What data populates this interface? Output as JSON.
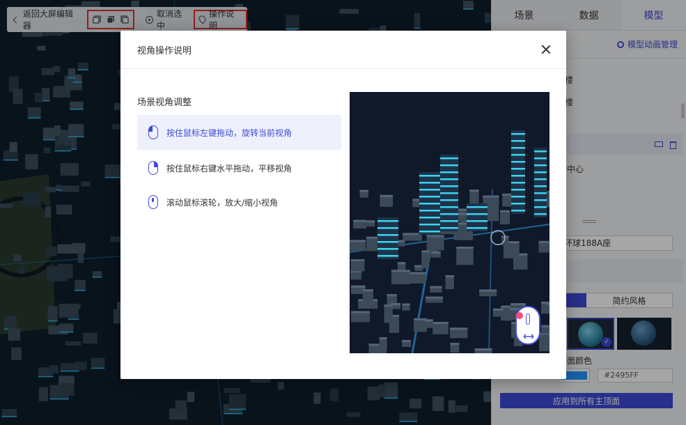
{
  "toolbar": {
    "back_label": "返回大屏编辑器",
    "deselect_label": "取消选中",
    "help_label": "操作说明"
  },
  "right_panel": {
    "tabs": [
      "场景",
      "数据",
      "模型"
    ],
    "active_tab": "模型",
    "anim_manage_label": "模型动画管理",
    "list_items": [
      "楼",
      "楼"
    ],
    "selected_item": "中心",
    "link_text": "",
    "name_value": "环球188A座",
    "style_option": "简约风格",
    "color_label": "面颜色",
    "color_value": "#2495FF",
    "color_hex": "#2495FF",
    "apply_button": "应用到所有主顶面"
  },
  "modal": {
    "title": "视角操作说明",
    "section_title": "场景视角调整",
    "items": [
      {
        "label": "按住鼠标左键拖动，旋转当前视角",
        "icon": "mouse-left-icon"
      },
      {
        "label": "按住鼠标右键水平拖动，平移视角",
        "icon": "mouse-right-icon"
      },
      {
        "label": "滚动鼠标滚轮，放大/缩小视角",
        "icon": "mouse-wheel-icon"
      }
    ],
    "active_index": 0
  },
  "colors": {
    "accent": "#3d4bd4",
    "highlight_border": "#e0312b"
  }
}
